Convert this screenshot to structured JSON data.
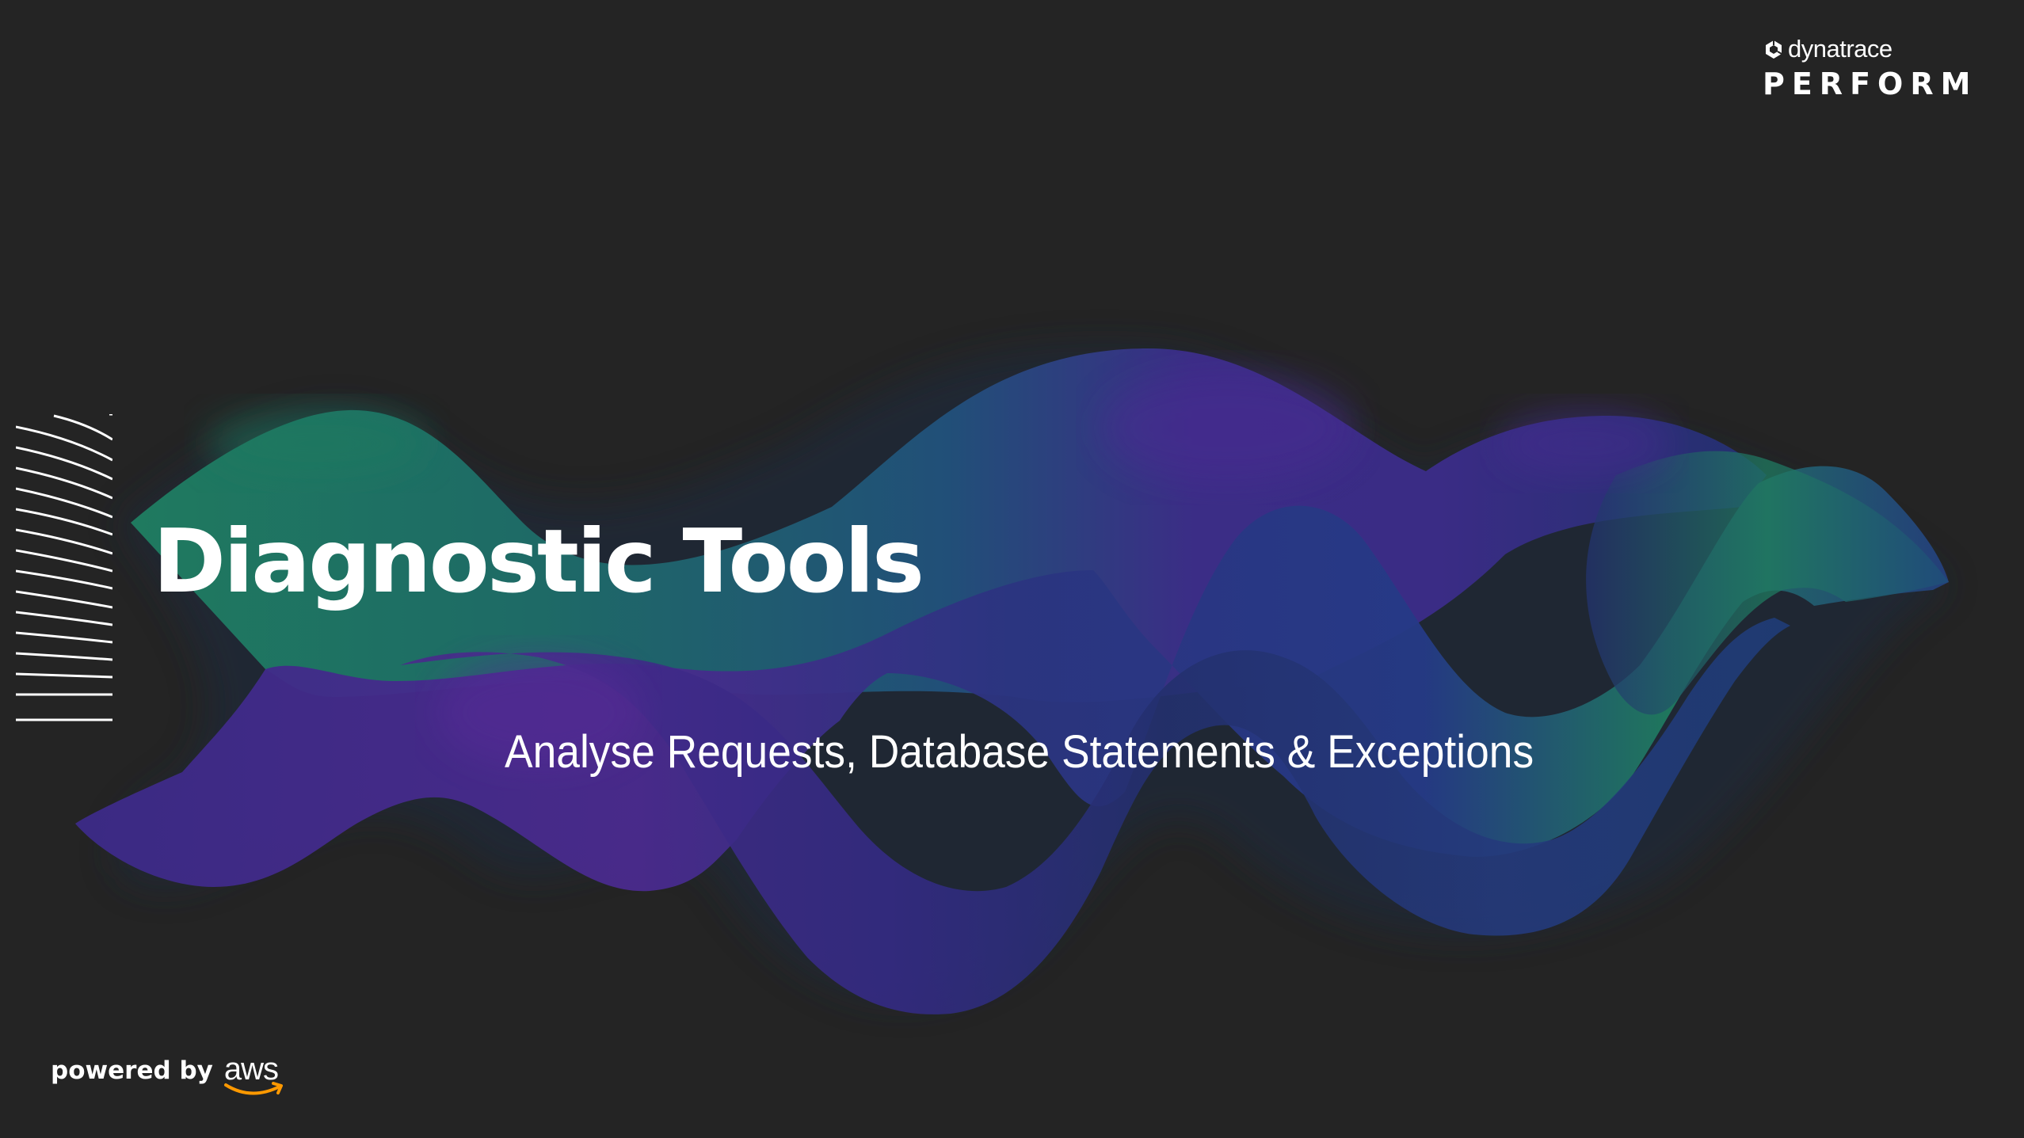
{
  "slide": {
    "title": "Diagnostic Tools",
    "subtitle": "Analyse Requests, Database Statements & Exceptions"
  },
  "branding": {
    "company": "dynatrace",
    "event": "PERFORM",
    "logo_icon": "dynatrace-logo-icon"
  },
  "footer": {
    "powered_by": "powered by",
    "partner": "aws",
    "partner_icon": "aws-smile-icon"
  },
  "colors": {
    "background": "#242424",
    "text": "#ffffff",
    "wave_green": "#1f7a5f",
    "wave_teal": "#1d5d6e",
    "wave_purple": "#4b2a8c",
    "wave_blue": "#23306e",
    "aws_orange": "#f90"
  }
}
